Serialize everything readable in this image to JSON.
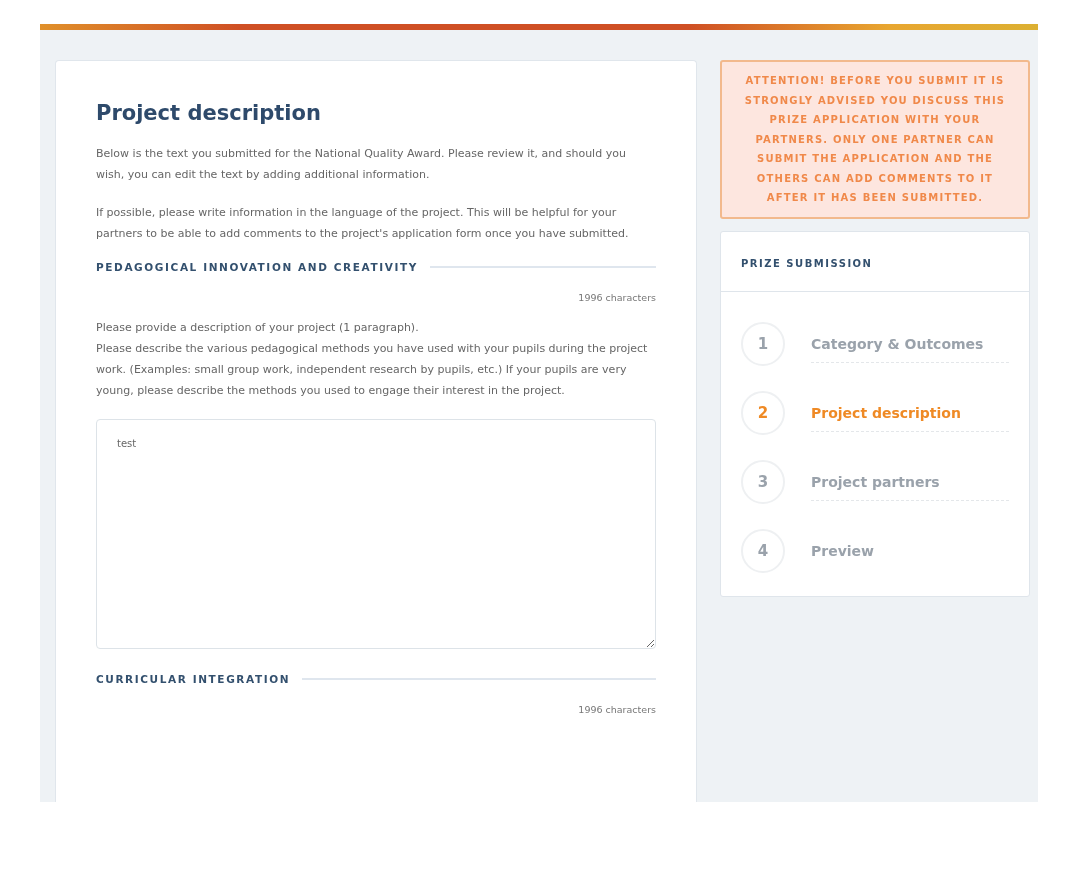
{
  "main": {
    "title": "Project description",
    "intro": [
      "Below is the text you submitted for the National Quality Award. Please review it, and should you wish, you can edit the text by adding additional information.",
      "If possible, please write information in the language of the project. This will be helpful for your partners to be able to add comments to the project's application form once you have submitted."
    ],
    "sections": [
      {
        "heading": "PEDAGOGICAL INNOVATION AND CREATIVITY",
        "count": "1996 characters",
        "prompts": [
          "Please provide a description of your project (1 paragraph).",
          "Please describe the various pedagogical methods you have used with your pupils during the project work. (Examples: small group work, independent research by pupils, etc.) If your pupils are very young, please describe the methods you used to engage their interest in the project."
        ],
        "value": "test"
      },
      {
        "heading": "CURRICULAR INTEGRATION",
        "count": "1996 characters"
      }
    ]
  },
  "sidebar": {
    "attention": "ATTENTION! BEFORE YOU SUBMIT IT IS STRONGLY ADVISED YOU DISCUSS THIS PRIZE APPLICATION WITH YOUR PARTNERS. ONLY ONE PARTNER CAN SUBMIT THE APPLICATION AND THE OTHERS CAN ADD COMMENTS TO IT AFTER IT HAS BEEN SUBMITTED.",
    "title": "PRIZE SUBMISSION",
    "steps": [
      {
        "number": "1",
        "label": "Category & Outcomes",
        "selected": false
      },
      {
        "number": "2",
        "label": "Project description",
        "selected": true
      },
      {
        "number": "3",
        "label": "Project partners",
        "selected": false
      },
      {
        "number": "4",
        "label": "Preview",
        "selected": false
      }
    ]
  }
}
